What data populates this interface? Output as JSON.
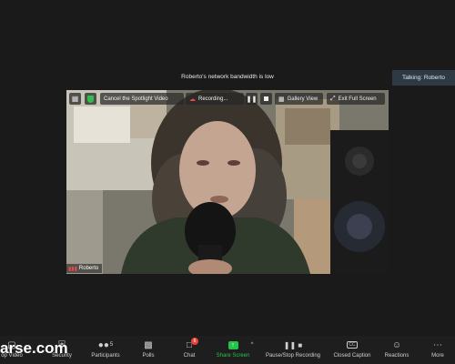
{
  "notice": "Roberto's network bandwidth is low",
  "talking": "Talking: Roberto",
  "video_toolbar": {
    "spotlight": "Cancel the Spotlight Video",
    "recording": "Recording...",
    "gallery": "Gallery View",
    "exit_full": "Exit Full Screen"
  },
  "participant_name": "Roberto",
  "toolbar": {
    "video": "op Video",
    "security": "Security",
    "participants": "Participants",
    "participants_count": "5",
    "polls": "Polls",
    "chat": "Chat",
    "chat_badge": "6",
    "share": "Share Screen",
    "recording": "Pause/Stop Recording",
    "cc": "Closed Caption",
    "cc_icon_text": "CC",
    "reactions": "Reactions",
    "more": "More"
  },
  "watermark": "arse.com",
  "colors": {
    "share_green": "#27c24c",
    "badge_red": "#e8423a",
    "rec_red": "#e5484d"
  }
}
